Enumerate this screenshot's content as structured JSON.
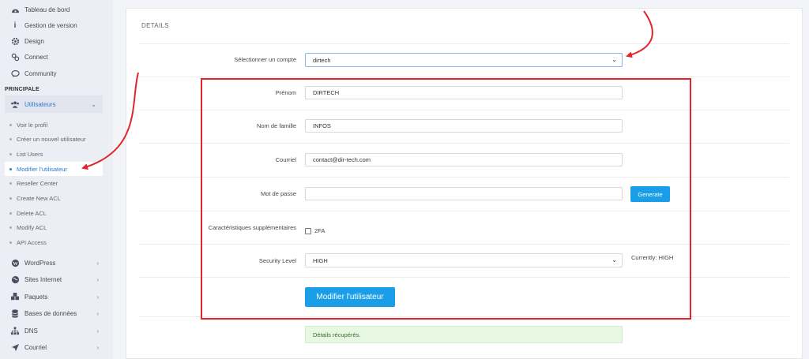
{
  "sidebar": {
    "top_items": [
      {
        "label": "Tableau de bord",
        "icon": "dashboard-icon"
      },
      {
        "label": "Gestion de version",
        "icon": "info-icon"
      },
      {
        "label": "Design",
        "icon": "gear-icon"
      },
      {
        "label": "Connect",
        "icon": "link-icon"
      },
      {
        "label": "Community",
        "icon": "chat-icon"
      }
    ],
    "section_title": "PRINCIPALE",
    "users_group": {
      "label": "Utilisateurs",
      "icon": "users-icon",
      "items": [
        {
          "label": "Voir le profil"
        },
        {
          "label": "Créer un nouvel utilisateur"
        },
        {
          "label": "List Users"
        },
        {
          "label": "Modifier l'utilisateur",
          "active": true
        },
        {
          "label": "Reseller Center"
        },
        {
          "label": "Create New ACL"
        },
        {
          "label": "Delete ACL"
        },
        {
          "label": "Modify ACL"
        },
        {
          "label": "API Access"
        }
      ]
    },
    "bottom_items": [
      {
        "label": "WordPress",
        "icon": "wordpress-icon"
      },
      {
        "label": "Sites Internet",
        "icon": "globe-icon"
      },
      {
        "label": "Paquets",
        "icon": "packages-icon"
      },
      {
        "label": "Bases de données",
        "icon": "database-icon"
      },
      {
        "label": "DNS",
        "icon": "network-icon"
      },
      {
        "label": "Courriel",
        "icon": "send-icon"
      }
    ]
  },
  "form": {
    "section_title": "DETAILS",
    "account": {
      "label": "Sélectionner un compte",
      "value": "dirtech"
    },
    "first_name": {
      "label": "Prénom",
      "value": "DIRTECH"
    },
    "last_name": {
      "label": "Nom de famille",
      "value": "INFOS"
    },
    "email": {
      "label": "Courriel",
      "value": "contact@dir-tech.com"
    },
    "password": {
      "label": "Mot de passe",
      "value": "",
      "generate_label": "Generate"
    },
    "extra": {
      "label": "Caractéristiques supplémentaires",
      "twofa_label": "2FA",
      "twofa_checked": false
    },
    "security": {
      "label": "Security Level",
      "value": "HIGH",
      "current_text": "Currently: HIGH"
    },
    "submit_label": "Modifier l'utilisateur",
    "status_message": "Détails récupérés."
  },
  "colors": {
    "accent": "#1a9ee8",
    "annotation": "#e0252c",
    "success_bg": "#e6f8e2"
  }
}
